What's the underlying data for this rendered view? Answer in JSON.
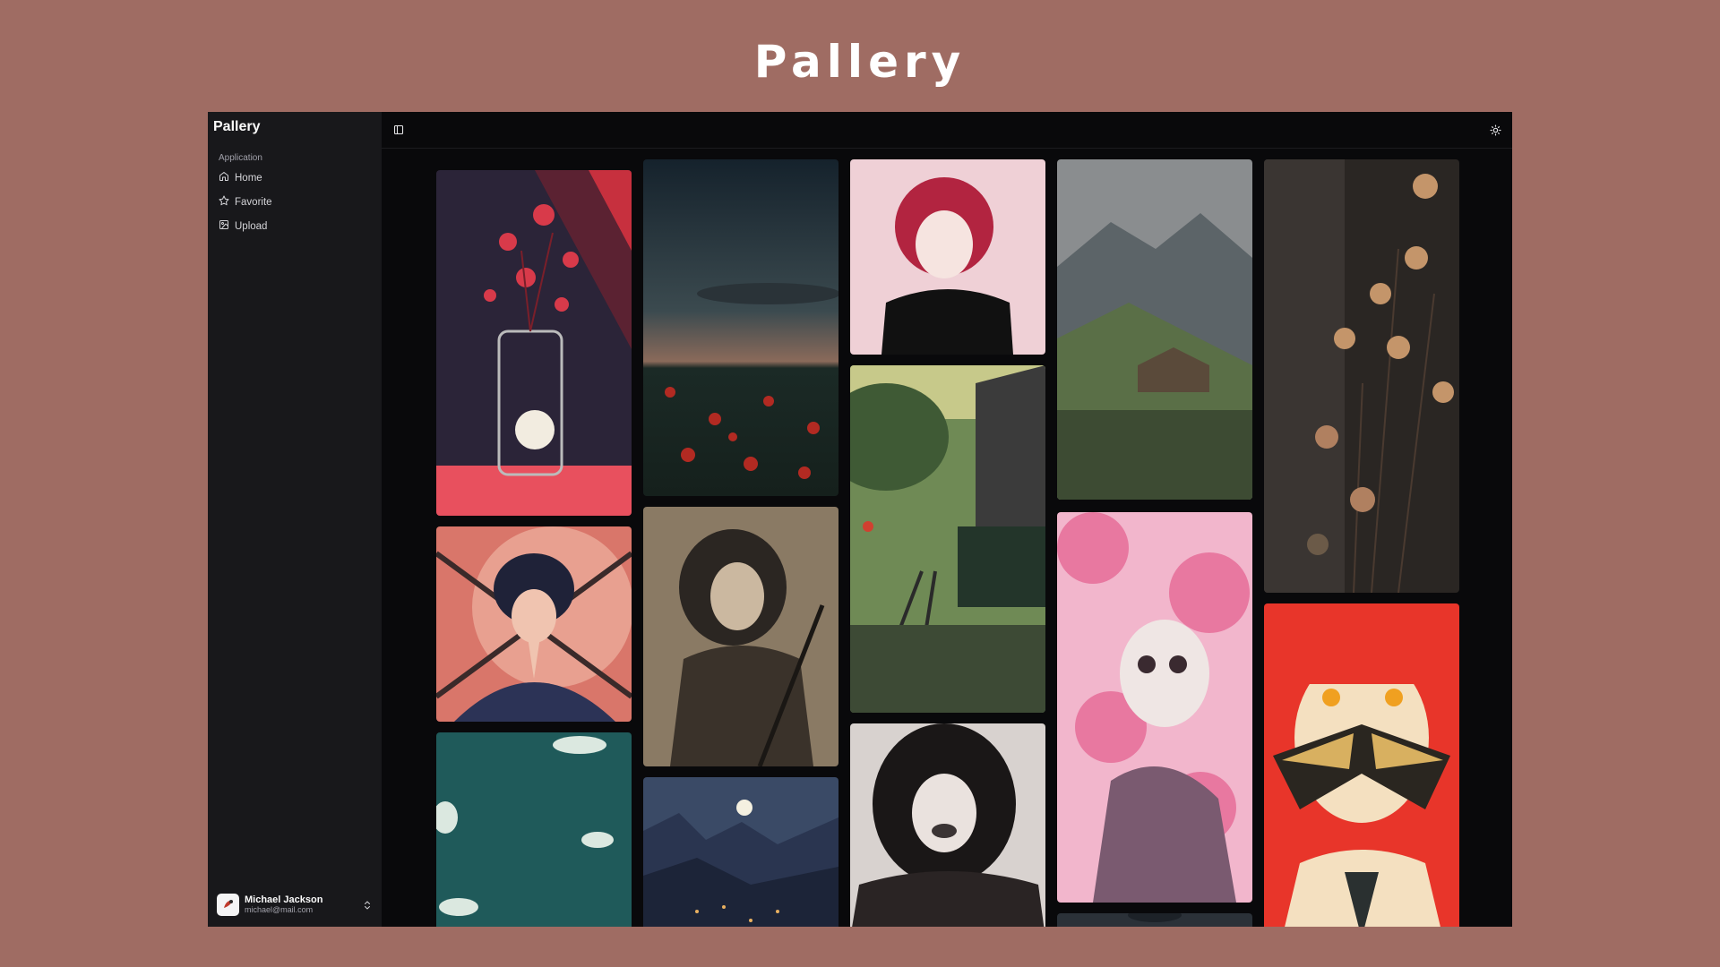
{
  "hero": {
    "title": "Pallery"
  },
  "sidebar": {
    "brand": "Pallery",
    "group_label": "Application",
    "items": [
      {
        "label": "Home",
        "icon": "home-icon"
      },
      {
        "label": "Favorite",
        "icon": "star-icon"
      },
      {
        "label": "Upload",
        "icon": "image-upload-icon"
      }
    ],
    "user": {
      "name": "Michael Jackson",
      "email": "michael@mail.com"
    }
  },
  "topbar": {
    "toggle_icon": "sidebar-toggle-icon",
    "theme_icon": "sun-icon"
  },
  "colors": {
    "page_bg": "#9f6c63",
    "app_bg": "#09090b",
    "sidebar_bg": "#18181b"
  },
  "gallery": {
    "columns": [
      [
        {
          "subject": "red flowers in glass jar",
          "palette": [
            "#2b2438",
            "#c7303e",
            "#e8505e"
          ]
        },
        {
          "subject": "praying woman with swords",
          "palette": [
            "#1f2238",
            "#d9766a",
            "#2c3356"
          ]
        },
        {
          "subject": "teal sky with clouds",
          "palette": [
            "#1f5a5a",
            "#2e6d6b",
            "#dbe8e0"
          ]
        }
      ],
      [
        {
          "subject": "poppy field at dusk",
          "palette": [
            "#1b2c38",
            "#3b4a4f",
            "#b22a22"
          ]
        },
        {
          "subject": "woman in striped dress",
          "palette": [
            "#8a7a64",
            "#2b2622",
            "#cbb8a0"
          ]
        },
        {
          "subject": "moonlit mountain town",
          "palette": [
            "#3a4a66",
            "#1c2438",
            "#e8b060"
          ]
        }
      ],
      [
        {
          "subject": "red-haired girl portrait",
          "palette": [
            "#efd0d6",
            "#111111",
            "#b22440"
          ]
        },
        {
          "subject": "railway station in forest",
          "palette": [
            "#6f8a55",
            "#23352a",
            "#3b3b3b"
          ]
        },
        {
          "subject": "laughing dark-haired woman",
          "palette": [
            "#d8d2cf",
            "#1a1717",
            "#3b3434"
          ]
        }
      ],
      [
        {
          "subject": "misty mountain cottage",
          "palette": [
            "#8a8d8f",
            "#5a6f47",
            "#3d4b33"
          ]
        },
        {
          "subject": "skeleton with cherry blossoms",
          "palette": [
            "#f2b6cc",
            "#e878a0",
            "#7a5a70"
          ]
        },
        {
          "subject": "dark landscape",
          "palette": [
            "#2b3138",
            "#1d2228",
            "#3a4049"
          ]
        }
      ],
      [
        {
          "subject": "dried flowers in shadow",
          "palette": [
            "#2a2623",
            "#6b5a48",
            "#c4956a"
          ]
        },
        {
          "subject": "red-haired girl with butterfly",
          "palette": [
            "#e8352a",
            "#f4e0c0",
            "#2a2620"
          ]
        }
      ]
    ]
  }
}
